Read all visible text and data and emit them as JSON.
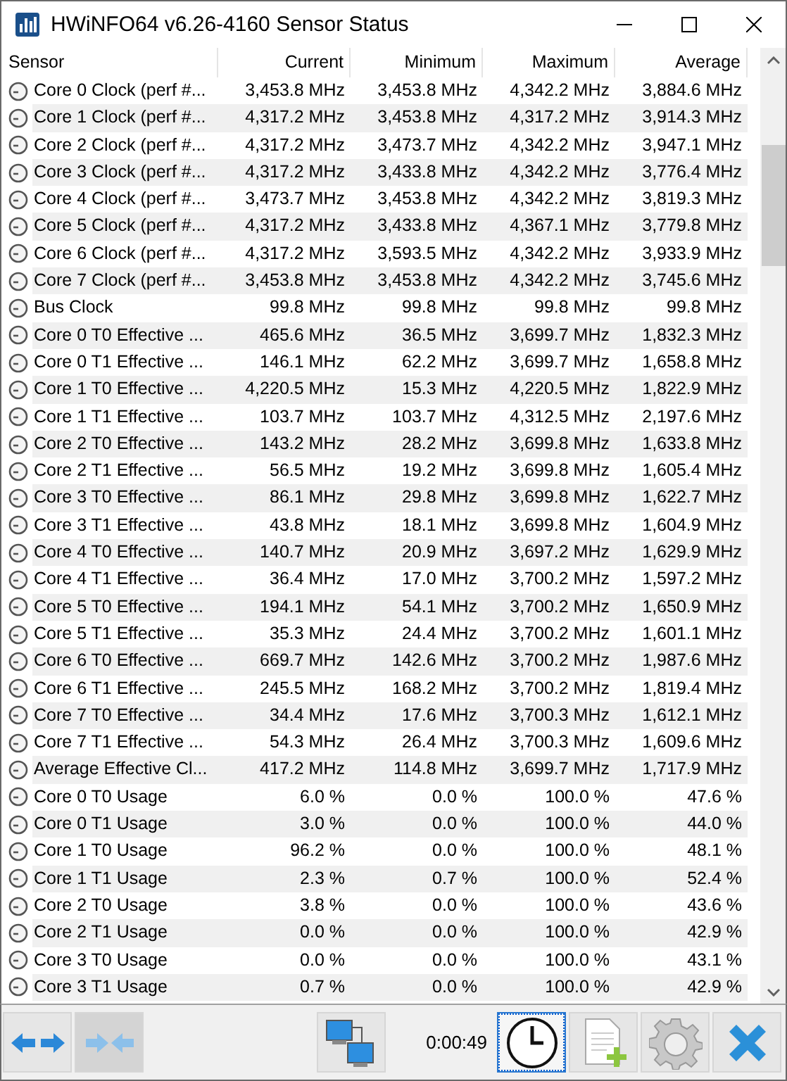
{
  "window": {
    "title": "HWiNFO64 v6.26-4160 Sensor Status"
  },
  "table": {
    "columns": [
      "Sensor",
      "Current",
      "Minimum",
      "Maximum",
      "Average"
    ],
    "rows": [
      [
        "Core 0 Clock (perf #...",
        "3,453.8 MHz",
        "3,453.8 MHz",
        "4,342.2 MHz",
        "3,884.6 MHz"
      ],
      [
        "Core 1 Clock (perf #...",
        "4,317.2 MHz",
        "3,453.8 MHz",
        "4,317.2 MHz",
        "3,914.3 MHz"
      ],
      [
        "Core 2 Clock (perf #...",
        "4,317.2 MHz",
        "3,473.7 MHz",
        "4,342.2 MHz",
        "3,947.1 MHz"
      ],
      [
        "Core 3 Clock (perf #...",
        "4,317.2 MHz",
        "3,433.8 MHz",
        "4,342.2 MHz",
        "3,776.4 MHz"
      ],
      [
        "Core 4 Clock (perf #...",
        "3,473.7 MHz",
        "3,453.8 MHz",
        "4,342.2 MHz",
        "3,819.3 MHz"
      ],
      [
        "Core 5 Clock (perf #...",
        "4,317.2 MHz",
        "3,433.8 MHz",
        "4,367.1 MHz",
        "3,779.8 MHz"
      ],
      [
        "Core 6 Clock (perf #...",
        "4,317.2 MHz",
        "3,593.5 MHz",
        "4,342.2 MHz",
        "3,933.9 MHz"
      ],
      [
        "Core 7 Clock (perf #...",
        "3,453.8 MHz",
        "3,453.8 MHz",
        "4,342.2 MHz",
        "3,745.6 MHz"
      ],
      [
        "Bus Clock",
        "99.8 MHz",
        "99.8 MHz",
        "99.8 MHz",
        "99.8 MHz"
      ],
      [
        "Core 0 T0 Effective ...",
        "465.6 MHz",
        "36.5 MHz",
        "3,699.7 MHz",
        "1,832.3 MHz"
      ],
      [
        "Core 0 T1 Effective ...",
        "146.1 MHz",
        "62.2 MHz",
        "3,699.7 MHz",
        "1,658.8 MHz"
      ],
      [
        "Core 1 T0 Effective ...",
        "4,220.5 MHz",
        "15.3 MHz",
        "4,220.5 MHz",
        "1,822.9 MHz"
      ],
      [
        "Core 1 T1 Effective ...",
        "103.7 MHz",
        "103.7 MHz",
        "4,312.5 MHz",
        "2,197.6 MHz"
      ],
      [
        "Core 2 T0 Effective ...",
        "143.2 MHz",
        "28.2 MHz",
        "3,699.8 MHz",
        "1,633.8 MHz"
      ],
      [
        "Core 2 T1 Effective ...",
        "56.5 MHz",
        "19.2 MHz",
        "3,699.8 MHz",
        "1,605.4 MHz"
      ],
      [
        "Core 3 T0 Effective ...",
        "86.1 MHz",
        "29.8 MHz",
        "3,699.8 MHz",
        "1,622.7 MHz"
      ],
      [
        "Core 3 T1 Effective ...",
        "43.8 MHz",
        "18.1 MHz",
        "3,699.8 MHz",
        "1,604.9 MHz"
      ],
      [
        "Core 4 T0 Effective ...",
        "140.7 MHz",
        "20.9 MHz",
        "3,697.2 MHz",
        "1,629.9 MHz"
      ],
      [
        "Core 4 T1 Effective ...",
        "36.4 MHz",
        "17.0 MHz",
        "3,700.2 MHz",
        "1,597.2 MHz"
      ],
      [
        "Core 5 T0 Effective ...",
        "194.1 MHz",
        "54.1 MHz",
        "3,700.2 MHz",
        "1,650.9 MHz"
      ],
      [
        "Core 5 T1 Effective ...",
        "35.3 MHz",
        "24.4 MHz",
        "3,700.2 MHz",
        "1,601.1 MHz"
      ],
      [
        "Core 6 T0 Effective ...",
        "669.7 MHz",
        "142.6 MHz",
        "3,700.2 MHz",
        "1,987.6 MHz"
      ],
      [
        "Core 6 T1 Effective ...",
        "245.5 MHz",
        "168.2 MHz",
        "3,700.2 MHz",
        "1,819.4 MHz"
      ],
      [
        "Core 7 T0 Effective ...",
        "34.4 MHz",
        "17.6 MHz",
        "3,700.3 MHz",
        "1,612.1 MHz"
      ],
      [
        "Core 7 T1 Effective ...",
        "54.3 MHz",
        "26.4 MHz",
        "3,700.3 MHz",
        "1,609.6 MHz"
      ],
      [
        "Average Effective Cl...",
        "417.2 MHz",
        "114.8 MHz",
        "3,699.7 MHz",
        "1,717.9 MHz"
      ],
      [
        "Core 0 T0 Usage",
        "6.0 %",
        "0.0 %",
        "100.0 %",
        "47.6 %"
      ],
      [
        "Core 0 T1 Usage",
        "3.0 %",
        "0.0 %",
        "100.0 %",
        "44.0 %"
      ],
      [
        "Core 1 T0 Usage",
        "96.2 %",
        "0.0 %",
        "100.0 %",
        "48.1 %"
      ],
      [
        "Core 1 T1 Usage",
        "2.3 %",
        "0.7 %",
        "100.0 %",
        "52.4 %"
      ],
      [
        "Core 2 T0 Usage",
        "3.8 %",
        "0.0 %",
        "100.0 %",
        "43.6 %"
      ],
      [
        "Core 2 T1 Usage",
        "0.0 %",
        "0.0 %",
        "100.0 %",
        "42.9 %"
      ],
      [
        "Core 3 T0 Usage",
        "0.0 %",
        "0.0 %",
        "100.0 %",
        "43.1 %"
      ],
      [
        "Core 3 T1 Usage",
        "0.7 %",
        "0.0 %",
        "100.0 %",
        "42.9 %"
      ]
    ]
  },
  "toolbar": {
    "timer": "0:00:49"
  }
}
